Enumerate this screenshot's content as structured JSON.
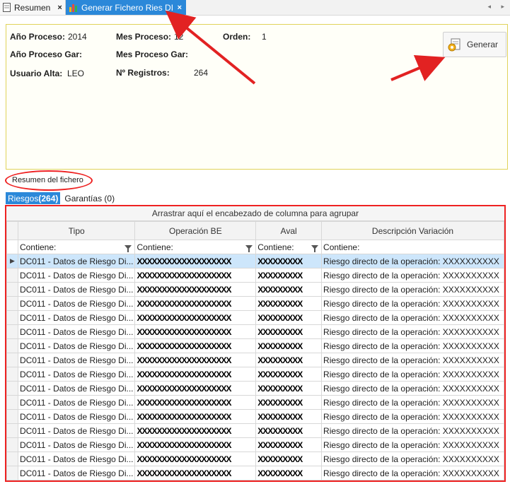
{
  "tabs": [
    {
      "label": "Resumen",
      "close": "×",
      "icon": "document-icon"
    },
    {
      "label": "Generar Fichero Ries DI",
      "close": "×",
      "icon": "chart-icon"
    }
  ],
  "scroll_arrows": "◂ ▸",
  "header": {
    "anio_proceso_label": "Año Proceso:",
    "anio_proceso_value": "2014",
    "mes_proceso_label": "Mes Proceso:",
    "mes_proceso_value": "12",
    "orden_label": "Orden:",
    "orden_value": "1",
    "anio_proceso_gar_label": "Año Proceso Gar:",
    "mes_proceso_gar_label": "Mes Proceso Gar:",
    "usuario_alta_label": "Usuario Alta:",
    "usuario_alta_value": "LEO",
    "num_registros_label": "Nº Registros:",
    "num_registros_value": "264"
  },
  "generar_button": {
    "label": "Generar",
    "icon": "gear-page-icon"
  },
  "resumen_label": "Resumen del fichero",
  "subtabs": {
    "riesgos": "Riesgos",
    "riesgos_count": "(264)",
    "garantias": "Garantías (0)"
  },
  "grid": {
    "group_hint": "Arrastrar aquí el encabezado de columna para agrupar",
    "columns": [
      "Tipo",
      "Operación BE",
      "Aval",
      "Descripción Variación"
    ],
    "filter_label": "Contiene:",
    "rows": [
      [
        "DC011 - Datos de Riesgo Di...",
        "XXXXXXXXXXXXXXXXXXX",
        "XXXXXXXXX",
        "Riesgo directo de la operación: XXXXXXXXXX"
      ],
      [
        "DC011 - Datos de Riesgo Di...",
        "XXXXXXXXXXXXXXXXXXX",
        "XXXXXXXXX",
        "Riesgo directo de la operación: XXXXXXXXXX"
      ],
      [
        "DC011 - Datos de Riesgo Di...",
        "XXXXXXXXXXXXXXXXXXX",
        "XXXXXXXXX",
        "Riesgo directo de la operación: XXXXXXXXXX"
      ],
      [
        "DC011 - Datos de Riesgo Di...",
        "XXXXXXXXXXXXXXXXXXX",
        "XXXXXXXXX",
        "Riesgo directo de la operación: XXXXXXXXXX"
      ],
      [
        "DC011 - Datos de Riesgo Di...",
        "XXXXXXXXXXXXXXXXXXX",
        "XXXXXXXXX",
        "Riesgo directo de la operación: XXXXXXXXXX"
      ],
      [
        "DC011 - Datos de Riesgo Di...",
        "XXXXXXXXXXXXXXXXXXX",
        "XXXXXXXXX",
        "Riesgo directo de la operación: XXXXXXXXXX"
      ],
      [
        "DC011 - Datos de Riesgo Di...",
        "XXXXXXXXXXXXXXXXXXX",
        "XXXXXXXXX",
        "Riesgo directo de la operación: XXXXXXXXXX"
      ],
      [
        "DC011 - Datos de Riesgo Di...",
        "XXXXXXXXXXXXXXXXXXX",
        "XXXXXXXXX",
        "Riesgo directo de la operación: XXXXXXXXXX"
      ],
      [
        "DC011 - Datos de Riesgo Di...",
        "XXXXXXXXXXXXXXXXXXX",
        "XXXXXXXXX",
        "Riesgo directo de la operación: XXXXXXXXXX"
      ],
      [
        "DC011 - Datos de Riesgo Di...",
        "XXXXXXXXXXXXXXXXXXX",
        "XXXXXXXXX",
        "Riesgo directo de la operación: XXXXXXXXXX"
      ],
      [
        "DC011 - Datos de Riesgo Di...",
        "XXXXXXXXXXXXXXXXXXX",
        "XXXXXXXXX",
        "Riesgo directo de la operación: XXXXXXXXXX"
      ],
      [
        "DC011 - Datos de Riesgo Di...",
        "XXXXXXXXXXXXXXXXXXX",
        "XXXXXXXXX",
        "Riesgo directo de la operación: XXXXXXXXXX"
      ],
      [
        "DC011 - Datos de Riesgo Di...",
        "XXXXXXXXXXXXXXXXXXX",
        "XXXXXXXXX",
        "Riesgo directo de la operación: XXXXXXXXXX"
      ],
      [
        "DC011 - Datos de Riesgo Di...",
        "XXXXXXXXXXXXXXXXXXX",
        "XXXXXXXXX",
        "Riesgo directo de la operación: XXXXXXXXXX"
      ],
      [
        "DC011 - Datos de Riesgo Di...",
        "XXXXXXXXXXXXXXXXXXX",
        "XXXXXXXXX",
        "Riesgo directo de la operación: XXXXXXXXXX"
      ],
      [
        "DC011 - Datos de Riesgo Di...",
        "XXXXXXXXXXXXXXXXXXX",
        "XXXXXXXXX",
        "Riesgo directo de la operación: XXXXXXXXXX"
      ]
    ]
  },
  "colors": {
    "accent": "#2b88d9",
    "annotation": "#e22222",
    "selected_row": "#cde6fb"
  }
}
